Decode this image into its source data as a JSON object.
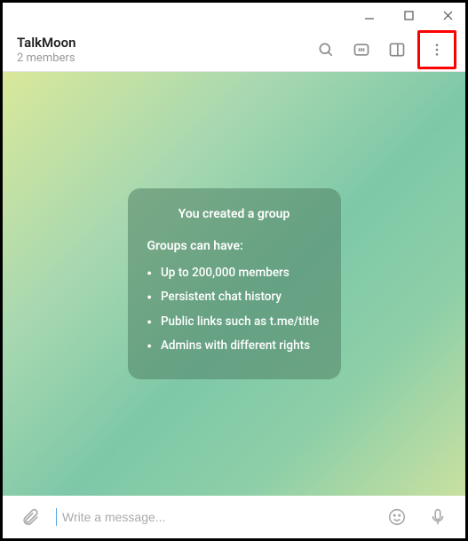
{
  "header": {
    "title": "TalkMoon",
    "subtitle": "2 members"
  },
  "info_card": {
    "title": "You created a group",
    "subtitle": "Groups can have:",
    "items": [
      "Up to 200,000 members",
      "Persistent chat history",
      "Public links such as t.me/title",
      "Admins with different rights"
    ]
  },
  "composer": {
    "placeholder": "Write a message..."
  }
}
